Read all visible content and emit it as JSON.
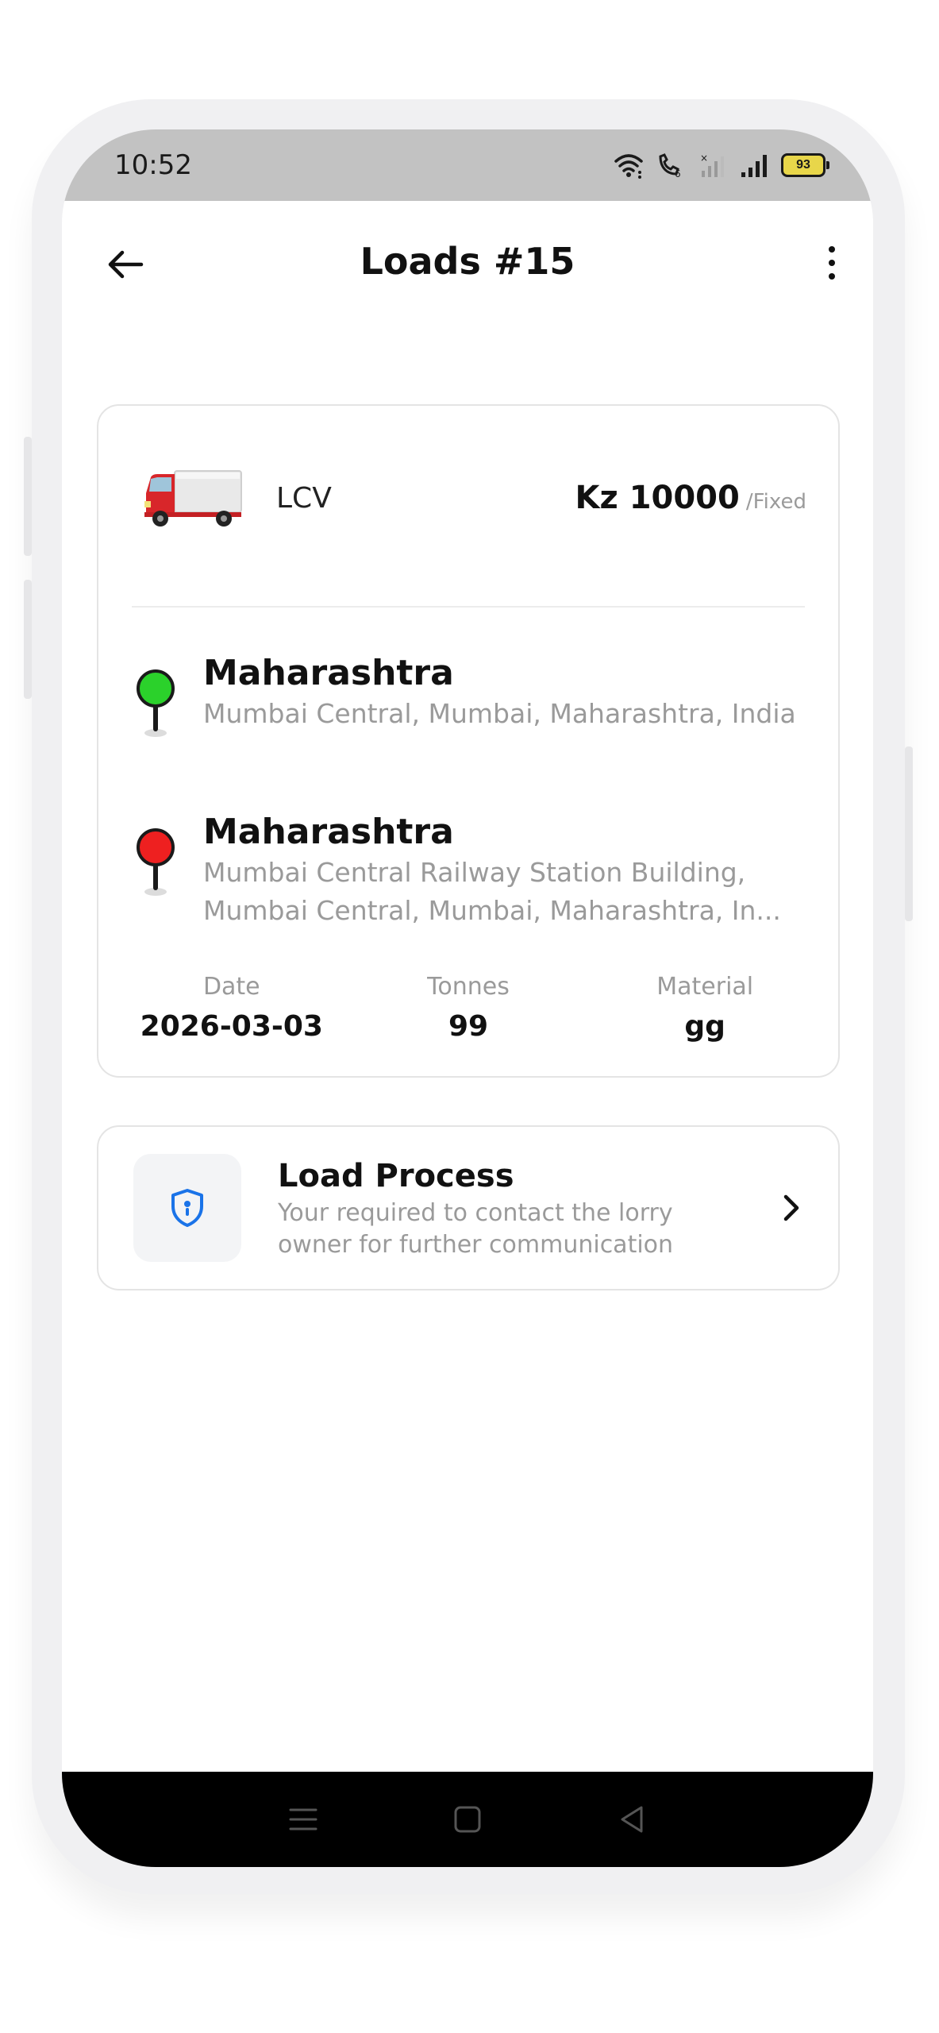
{
  "status_bar": {
    "time": "10:52",
    "battery": "93"
  },
  "app_bar": {
    "title": "Loads #15",
    "back_icon": "arrow-left-icon",
    "menu_icon": "more-vertical-icon"
  },
  "load": {
    "vehicle_type": "LCV",
    "price": "Kz 10000",
    "price_unit": "/Fixed",
    "pickup": {
      "title": "Maharashtra",
      "address": "Mumbai Central, Mumbai, Maharashtra, India",
      "pin_color": "#2bd12b"
    },
    "drop": {
      "title": "Maharashtra",
      "address_line1": "Mumbai Central Railway Station Building,",
      "address_line2": "Mumbai Central, Mumbai, Maharashtra, In...",
      "pin_color": "#ee2020"
    },
    "stats": {
      "date_label": "Date",
      "date_value": "2026-03-03",
      "tonnes_label": "Tonnes",
      "tonnes_value": "99",
      "material_label": "Material",
      "material_value": "gg"
    }
  },
  "process": {
    "title": "Load Process",
    "description": "Your required to contact the lorry owner for further communication",
    "icon": "shield-info-icon",
    "accent": "#1a73e8"
  },
  "nav_bar": {
    "recents_icon": "menu-lines-icon",
    "home_icon": "square-icon",
    "back_icon": "triangle-back-icon"
  }
}
